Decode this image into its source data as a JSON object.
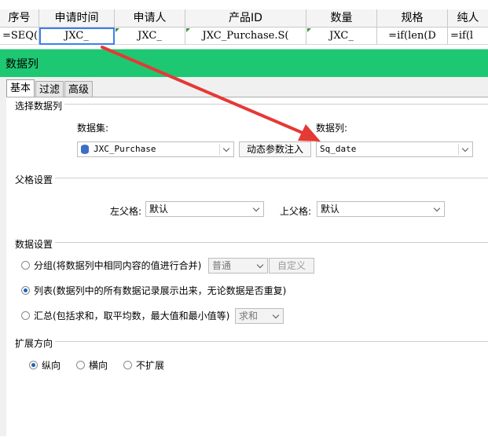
{
  "sheet": {
    "headers": [
      "序号",
      "申请时间",
      "申请人",
      "产品ID",
      "数量",
      "规格",
      "纯人"
    ],
    "cells": [
      "=SEQ()",
      "JXC_",
      "JXC_",
      "JXC_Purchase.S(",
      "JXC_",
      "=if(len(D",
      "=if(l"
    ]
  },
  "dialog": {
    "title": "数据列",
    "tabs": [
      "基本",
      "过滤",
      "高级"
    ],
    "select_group": {
      "title": "选择数据列",
      "dataset_label": "数据集:",
      "dataset_value": "JXC_Purchase",
      "dynamic_button": "动态参数注入",
      "column_label": "数据列:",
      "column_value": "Sq_date"
    },
    "parent_group": {
      "title": "父格设置",
      "left_label": "左父格:",
      "left_value": "默认",
      "top_label": "上父格:",
      "top_value": "默认"
    },
    "data_group": {
      "title": "数据设置",
      "option_group": "分组(将数据列中相同内容的值进行合并)",
      "group_select": "普通",
      "custom_button": "自定义",
      "option_list": "列表(数据列中的所有数据记录展示出来，无论数据是否重复)",
      "option_summary": "汇总(包括求和，取平均数，最大值和最小值等)",
      "summary_select": "求和"
    },
    "expand_group": {
      "title": "扩展方向",
      "vertical": "纵向",
      "horizontal": "横向",
      "none": "不扩展"
    }
  },
  "colors": {
    "titlebar": "#1ec873",
    "arrow": "#e53935",
    "selection": "#3c7ff0"
  }
}
